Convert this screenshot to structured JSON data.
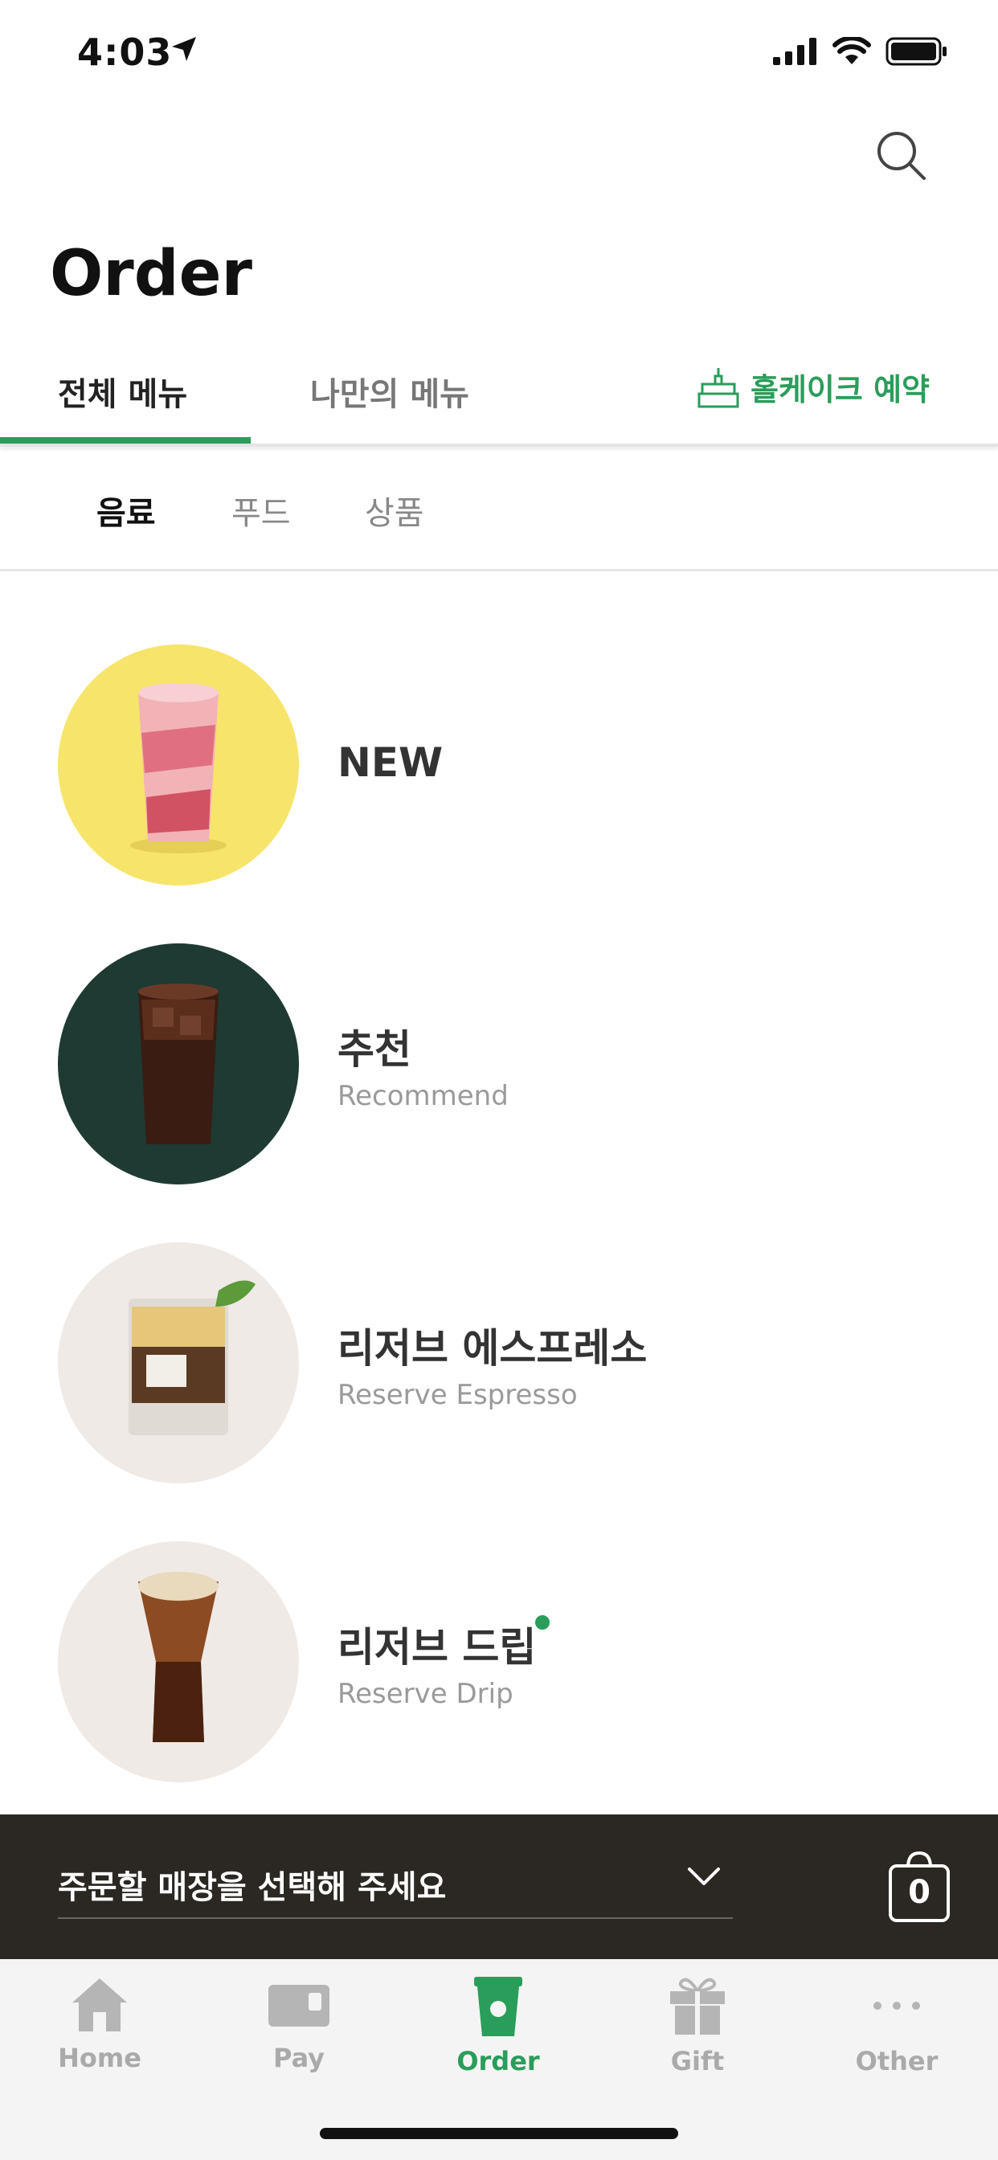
{
  "status_bar": {
    "time": "4:03"
  },
  "header": {
    "title": "Order"
  },
  "tabs": [
    {
      "label": "전체 메뉴",
      "active": true
    },
    {
      "label": "나만의 메뉴",
      "active": false
    }
  ],
  "cake_link": {
    "label": "홀케이크 예약"
  },
  "sub_categories": [
    {
      "label": "음료",
      "active": true
    },
    {
      "label": "푸드",
      "active": false
    },
    {
      "label": "상품",
      "active": false
    }
  ],
  "menu_items": [
    {
      "title": "NEW",
      "subtitle": ""
    },
    {
      "title": "추천",
      "subtitle": "Recommend"
    },
    {
      "title": "리저브 에스프레소",
      "subtitle": "Reserve Espresso"
    },
    {
      "title": "리저브 드립",
      "subtitle": "Reserve Drip"
    }
  ],
  "store_bar": {
    "prompt": "주문할 매장을 선택해 주세요",
    "cart_count": "0"
  },
  "bottom_nav": [
    {
      "label": "Home",
      "icon": "home-icon"
    },
    {
      "label": "Pay",
      "icon": "card-icon"
    },
    {
      "label": "Order",
      "icon": "cup-icon",
      "active": true
    },
    {
      "label": "Gift",
      "icon": "gift-icon"
    },
    {
      "label": "Other",
      "icon": "more-icon"
    }
  ],
  "colors": {
    "accent": "#2a9d5a",
    "store_bar": "#2b2723"
  }
}
